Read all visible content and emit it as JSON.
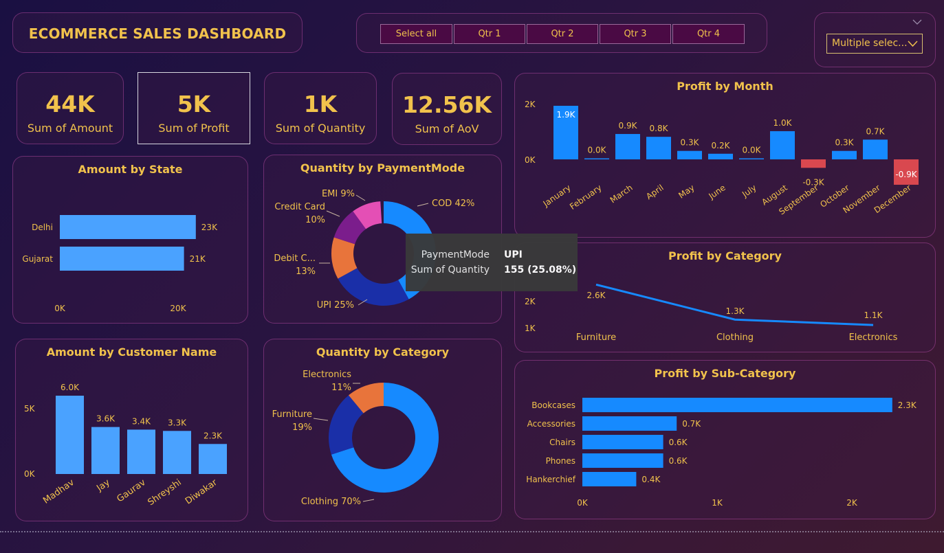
{
  "title": "ECOMMERCE SALES DASHBOARD",
  "slicer": {
    "buttons": [
      "Select all",
      "Qtr 1",
      "Qtr 2",
      "Qtr 3",
      "Qtr 4"
    ]
  },
  "dropdown": {
    "label": "Multiple selec...",
    "chevron_icon": "chevron-down-icon"
  },
  "kpis": [
    {
      "value": "44K",
      "label": "Sum of Amount"
    },
    {
      "value": "5K",
      "label": "Sum of Profit"
    },
    {
      "value": "1K",
      "label": "Sum of Quantity"
    },
    {
      "value": "12.56K",
      "label": "Sum of AoV"
    }
  ],
  "colors": {
    "accent": "#f1c24c",
    "bar_blue": "#4aa2ff",
    "bar_deep_blue": "#168aff",
    "negative": "#d9484f",
    "orange": "#e8743b",
    "navy": "#1a2fa8",
    "purple": "#7b1d8c",
    "pink": "#e44fb5"
  },
  "tooltip": {
    "rows": [
      {
        "label": "PaymentMode",
        "value": "UPI"
      },
      {
        "label": "Sum of Quantity",
        "value": "155 (25.08%)"
      }
    ]
  },
  "chart_data": [
    {
      "id": "amount-by-state",
      "type": "bar",
      "orientation": "horizontal",
      "title": "Amount by State",
      "categories": [
        "Delhi",
        "Gujarat"
      ],
      "values": [
        23000,
        21000
      ],
      "value_labels": [
        "23K",
        "21K"
      ],
      "xlim": [
        0,
        25000
      ],
      "x_ticks": [
        "0K",
        "20K"
      ]
    },
    {
      "id": "quantity-by-paymentmode",
      "type": "pie",
      "donut": true,
      "title": "Quantity by PaymentMode",
      "slices": [
        {
          "name": "COD",
          "percent": 42,
          "label": "COD 42%"
        },
        {
          "name": "UPI",
          "percent": 25,
          "label": "UPI 25%"
        },
        {
          "name": "Debit C...",
          "percent": 13,
          "label": "Debit C...",
          "label2": "13%"
        },
        {
          "name": "Credit Card",
          "percent": 10,
          "label": "Credit Card",
          "label2": "10%"
        },
        {
          "name": "EMI",
          "percent": 9,
          "label": "EMI 9%"
        }
      ]
    },
    {
      "id": "profit-by-month",
      "type": "bar",
      "title": "Profit by Month",
      "categories": [
        "January",
        "February",
        "March",
        "April",
        "May",
        "June",
        "July",
        "August",
        "September",
        "October",
        "November",
        "December"
      ],
      "values": [
        1900,
        0,
        900,
        800,
        300,
        200,
        0,
        1000,
        -300,
        300,
        700,
        -900
      ],
      "value_labels": [
        "1.9K",
        "0.0K",
        "0.9K",
        "0.8K",
        "0.3K",
        "0.2K",
        "0.0K",
        "1.0K",
        "-0.3K",
        "0.3K",
        "0.7K",
        "-0.9K"
      ],
      "y_ticks": [
        "2K",
        "0K"
      ]
    },
    {
      "id": "profit-by-category",
      "type": "line",
      "title": "Profit by Category",
      "categories": [
        "Furniture",
        "Clothing",
        "Electronics"
      ],
      "values": [
        2600,
        1300,
        1100
      ],
      "value_labels": [
        "2.6K",
        "1.3K",
        "1.1K"
      ],
      "y_ticks": [
        "2K",
        "1K"
      ]
    },
    {
      "id": "amount-by-customer-name",
      "type": "bar",
      "title": "Amount by Customer Name",
      "categories": [
        "Madhav",
        "Jay",
        "Gaurav",
        "Shreyshi",
        "Diwakar"
      ],
      "values": [
        6000,
        3600,
        3400,
        3300,
        2300
      ],
      "value_labels": [
        "6.0K",
        "3.6K",
        "3.4K",
        "3.3K",
        "2.3K"
      ],
      "y_ticks": [
        "5K",
        "0K"
      ]
    },
    {
      "id": "quantity-by-category",
      "type": "pie",
      "donut": true,
      "title": "Quantity by Category",
      "slices": [
        {
          "name": "Clothing",
          "percent": 70,
          "label": "Clothing 70%"
        },
        {
          "name": "Furniture",
          "percent": 19,
          "label": "Furniture",
          "label2": "19%"
        },
        {
          "name": "Electronics",
          "percent": 11,
          "label": "Electronics",
          "label2": "11%"
        }
      ]
    },
    {
      "id": "profit-by-sub-category",
      "type": "bar",
      "orientation": "horizontal",
      "title": "Profit by Sub-Category",
      "categories": [
        "Bookcases",
        "Accessories",
        "Chairs",
        "Phones",
        "Hankerchief"
      ],
      "values": [
        2300,
        700,
        600,
        600,
        400
      ],
      "value_labels": [
        "2.3K",
        "0.7K",
        "0.6K",
        "0.6K",
        "0.4K"
      ],
      "x_ticks": [
        "0K",
        "1K",
        "2K"
      ]
    }
  ]
}
